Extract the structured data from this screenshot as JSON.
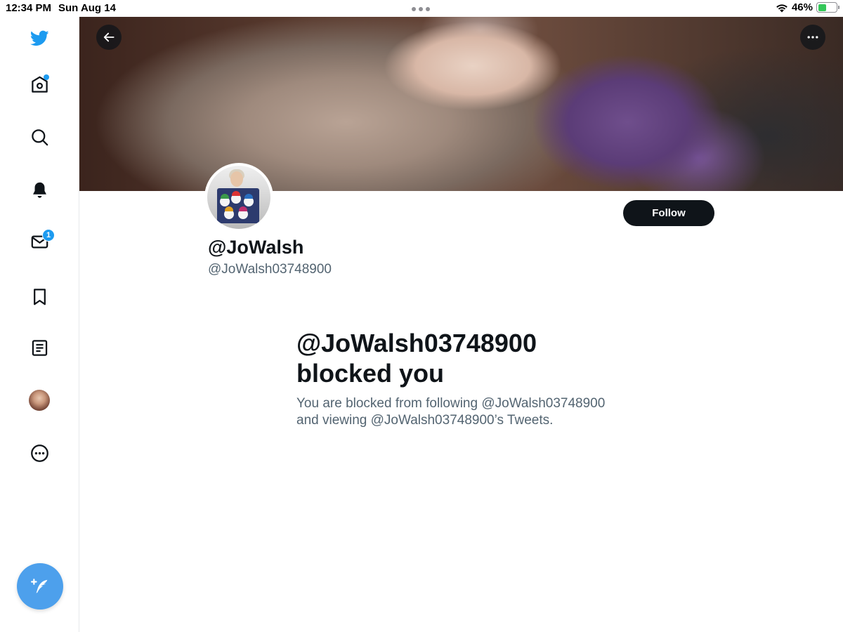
{
  "status_bar": {
    "time": "12:34 PM",
    "date": "Sun Aug 14",
    "battery_percent": "46%",
    "battery_level": 0.46
  },
  "sidebar": {
    "items": [
      {
        "name": "twitter-logo",
        "icon": "twitter-bird-icon"
      },
      {
        "name": "home",
        "icon": "home-icon",
        "has_dot": true
      },
      {
        "name": "explore",
        "icon": "search-icon"
      },
      {
        "name": "notifications",
        "icon": "bell-icon"
      },
      {
        "name": "messages",
        "icon": "mail-icon",
        "badge": "1"
      },
      {
        "name": "bookmarks",
        "icon": "bookmark-icon"
      },
      {
        "name": "lists",
        "icon": "list-icon"
      },
      {
        "name": "profile",
        "icon": "avatar"
      },
      {
        "name": "more",
        "icon": "more-circle-icon"
      }
    ],
    "compose_icon": "compose-tweet-icon",
    "messages_badge": "1"
  },
  "profile": {
    "display_name": "@JoWalsh",
    "handle": "@JoWalsh03748900",
    "follow_label": "Follow"
  },
  "blocked": {
    "title_line1": "@JoWalsh03748900",
    "title_line2": "blocked you",
    "desc_line1": "You are blocked from following @JoWalsh03748900",
    "desc_line2": "and viewing @JoWalsh03748900’s Tweets."
  },
  "colors": {
    "accent": "#1d9bf0",
    "text_primary": "#0f1419",
    "text_secondary": "#536471",
    "compose": "#4da0ec"
  }
}
